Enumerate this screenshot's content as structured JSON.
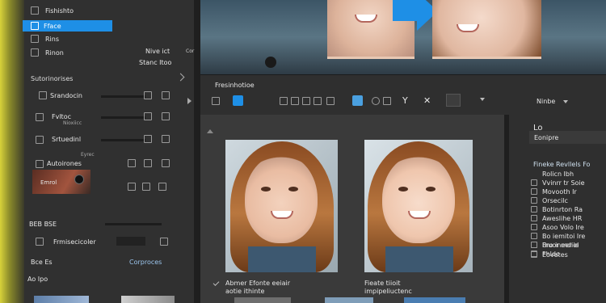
{
  "left_panel": {
    "top_items": [
      {
        "label": "Fishishto"
      },
      {
        "label": "Fface",
        "selected": true
      },
      {
        "label": "Rins"
      },
      {
        "label": "Rinon"
      }
    ],
    "right_labels": [
      "Nive ict",
      "Stanc Itoo"
    ],
    "section_title": "Sutorinorises",
    "rows": [
      "Srandocin",
      "Fvltoc",
      "Srtuedinl",
      "Autoirones"
    ],
    "sub_labels": [
      "Nioxiicc",
      "Eyrec"
    ],
    "inset_label": "Emrol",
    "bottom_section": "BEB BSE",
    "bottom_row_label": "Frmisecicoler",
    "footer_left": "Bce Es",
    "footer_right": "Corproces",
    "footer2": "Ao Ipo"
  },
  "top_right_tiny": "Cor",
  "toolbar": {
    "title": "Fresinhotioe",
    "zoom_label": "Ninbe"
  },
  "captions": {
    "left": [
      "Abmer Efonte eeiair",
      "aotie ithinte"
    ],
    "right": [
      "Fieate tiioit",
      "impipeliuctenc"
    ]
  },
  "right_panel": {
    "tab": "Lo",
    "panel_title": "Eonipre",
    "heading": "Fineke Revllels Fo",
    "items": [
      "Rolicn Ibh",
      "Vvinrr tr Soie",
      "Movooth Ir",
      "Orsecilc",
      "Botinrton Ra",
      "Aweslihe HR",
      "Asoo Volo Ire",
      "Bo iemitoi Ire",
      "Fruor mdiie",
      "Fhldo",
      "Bro ineenel",
      "Eovetes"
    ]
  },
  "colors": {
    "accent": "#1e8fe6",
    "panel": "#2b2b2b",
    "dark": "#1b1b1b"
  }
}
